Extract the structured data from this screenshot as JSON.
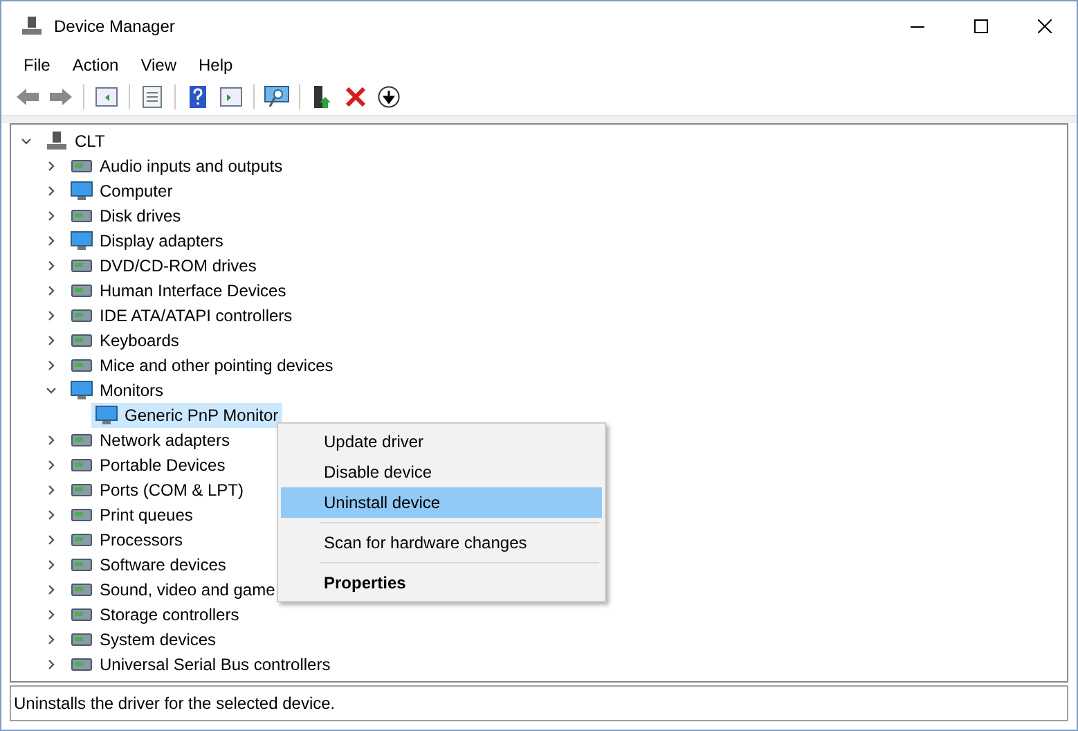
{
  "window": {
    "title": "Device Manager"
  },
  "menu_bar": [
    "File",
    "Action",
    "View",
    "Help"
  ],
  "tree": {
    "label": "CLT",
    "expanded": true,
    "selected": false,
    "children": [
      {
        "label": "Audio inputs and outputs",
        "expanded": false,
        "selected": false
      },
      {
        "label": "Computer",
        "expanded": false,
        "selected": false
      },
      {
        "label": "Disk drives",
        "expanded": false,
        "selected": false
      },
      {
        "label": "Display adapters",
        "expanded": false,
        "selected": false
      },
      {
        "label": "DVD/CD-ROM drives",
        "expanded": false,
        "selected": false
      },
      {
        "label": "Human Interface Devices",
        "expanded": false,
        "selected": false
      },
      {
        "label": "IDE ATA/ATAPI controllers",
        "expanded": false,
        "selected": false
      },
      {
        "label": "Keyboards",
        "expanded": false,
        "selected": false
      },
      {
        "label": "Mice and other pointing devices",
        "expanded": false,
        "selected": false
      },
      {
        "label": "Monitors",
        "expanded": true,
        "selected": false,
        "children": [
          {
            "label": "Generic PnP Monitor",
            "selected": true
          }
        ]
      },
      {
        "label": "Network adapters",
        "expanded": false,
        "selected": false
      },
      {
        "label": "Portable Devices",
        "expanded": false,
        "selected": false
      },
      {
        "label": "Ports (COM & LPT)",
        "expanded": false,
        "selected": false
      },
      {
        "label": "Print queues",
        "expanded": false,
        "selected": false
      },
      {
        "label": "Processors",
        "expanded": false,
        "selected": false
      },
      {
        "label": "Software devices",
        "expanded": false,
        "selected": false
      },
      {
        "label": "Sound, video and game",
        "expanded": false,
        "selected": false
      },
      {
        "label": "Storage controllers",
        "expanded": false,
        "selected": false
      },
      {
        "label": "System devices",
        "expanded": false,
        "selected": false
      },
      {
        "label": "Universal Serial Bus controllers",
        "expanded": false,
        "selected": false
      }
    ]
  },
  "context_menu": [
    {
      "label": "Update driver",
      "highlighted": false,
      "separator_before": false,
      "bold": false
    },
    {
      "label": "Disable device",
      "highlighted": false,
      "separator_before": false,
      "bold": false
    },
    {
      "label": "Uninstall device",
      "highlighted": true,
      "separator_before": false,
      "bold": false
    },
    {
      "label": "Scan for hardware changes",
      "highlighted": false,
      "separator_before": true,
      "bold": false
    },
    {
      "label": "Properties",
      "highlighted": false,
      "separator_before": true,
      "bold": true
    }
  ],
  "status_bar": "Uninstalls the driver for the selected device."
}
